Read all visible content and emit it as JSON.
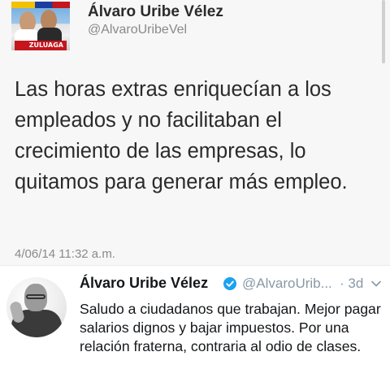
{
  "tweet_old": {
    "author_name": "Álvaro Uribe Vélez",
    "handle": "@AlvaroUribeVel",
    "avatar_banner": "ZULUAGA",
    "text": "Las horas extras enriquecían a los empleados y no facilitaban el crecimiento de las empresas, lo quitamos para generar más empleo.",
    "date": "4/06/14 11:32 a.m."
  },
  "tweet_new": {
    "author_name": "Álvaro Uribe Vélez",
    "handle": "@AlvaroUrib...",
    "time": "· 3d",
    "text": "Saludo a ciudadanos que trabajan. Mejor pagar salarios dignos y bajar impuestos. Por una relación fraterna, contraria al odio de clases.",
    "verified_icon": "verified-badge-icon",
    "menu_icon": "chevron-down-icon"
  },
  "colors": {
    "verified_blue": "#1da1f2",
    "muted_gray": "#8899a6",
    "old_bg": "#f7f7f7"
  }
}
